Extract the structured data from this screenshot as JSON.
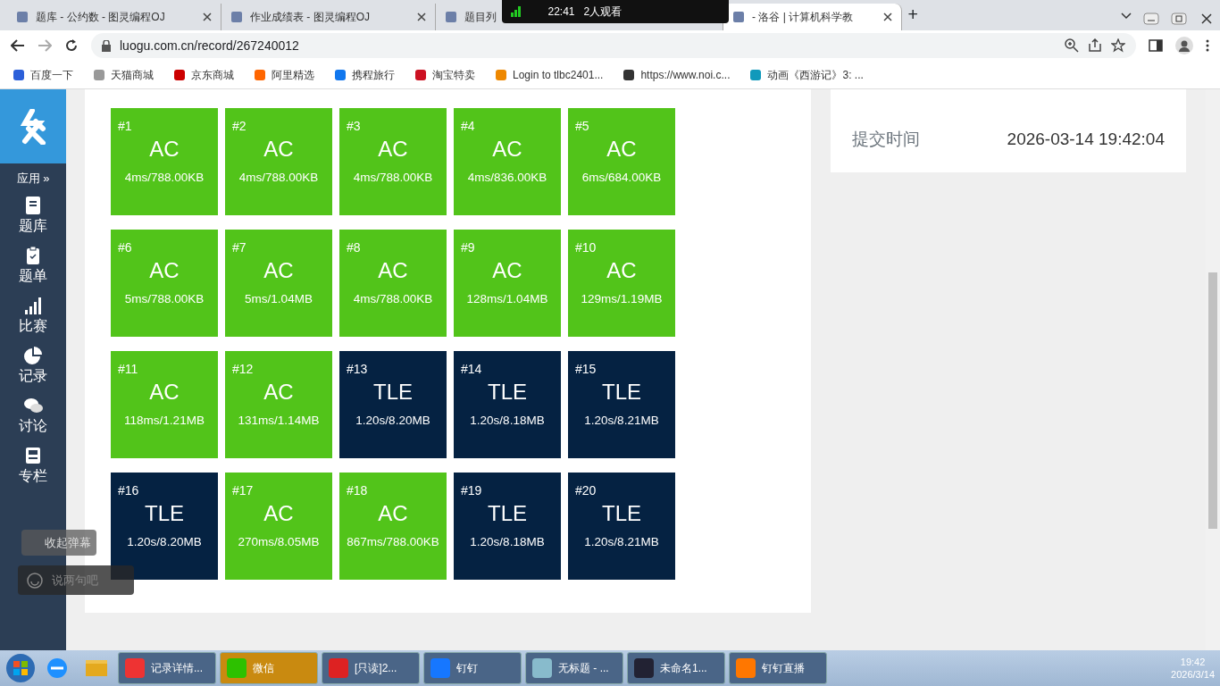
{
  "browser": {
    "tabs": [
      {
        "title": "题库 - 公约数 - 图灵编程OJ",
        "selected": false
      },
      {
        "title": "作业成绩表 - 图灵编程OJ",
        "selected": false
      },
      {
        "title": "题目列",
        "selected": false
      },
      {
        "title": "- 洛谷 | 计算机科学教",
        "selected": true
      }
    ],
    "new_tab": "+",
    "address": "luogu.com.cn/record/267240012",
    "bookmarks": [
      "百度一下",
      "天猫商城",
      "京东商城",
      "阿里精选",
      "携程旅行",
      "淘宝特卖",
      "Login to tlbc2401...",
      "https://www.noi.c...",
      "动画《西游记》3: ..."
    ]
  },
  "live_overlay": {
    "time": "22:41",
    "viewers": "2人观看"
  },
  "sidebar": {
    "apps": "应用 »",
    "items": [
      {
        "label": "题库",
        "kind": "book"
      },
      {
        "label": "题单",
        "kind": "clipboard"
      },
      {
        "label": "比赛",
        "kind": "bars"
      },
      {
        "label": "记录",
        "kind": "pie"
      },
      {
        "label": "讨论",
        "kind": "chat"
      },
      {
        "label": "专栏",
        "kind": "news"
      }
    ]
  },
  "testcases": [
    {
      "number": "#1",
      "status": "AC",
      "detail": "4ms/788.00KB"
    },
    {
      "number": "#2",
      "status": "AC",
      "detail": "4ms/788.00KB"
    },
    {
      "number": "#3",
      "status": "AC",
      "detail": "4ms/788.00KB"
    },
    {
      "number": "#4",
      "status": "AC",
      "detail": "4ms/836.00KB"
    },
    {
      "number": "#5",
      "status": "AC",
      "detail": "6ms/684.00KB"
    },
    {
      "number": "#6",
      "status": "AC",
      "detail": "5ms/788.00KB"
    },
    {
      "number": "#7",
      "status": "AC",
      "detail": "5ms/1.04MB"
    },
    {
      "number": "#8",
      "status": "AC",
      "detail": "4ms/788.00KB"
    },
    {
      "number": "#9",
      "status": "AC",
      "detail": "128ms/1.04MB"
    },
    {
      "number": "#10",
      "status": "AC",
      "detail": "129ms/1.19MB"
    },
    {
      "number": "#11",
      "status": "AC",
      "detail": "118ms/1.21MB"
    },
    {
      "number": "#12",
      "status": "AC",
      "detail": "131ms/1.14MB"
    },
    {
      "number": "#13",
      "status": "TLE",
      "detail": "1.20s/8.20MB"
    },
    {
      "number": "#14",
      "status": "TLE",
      "detail": "1.20s/8.18MB"
    },
    {
      "number": "#15",
      "status": "TLE",
      "detail": "1.20s/8.21MB"
    },
    {
      "number": "#16",
      "status": "TLE",
      "detail": "1.20s/8.20MB"
    },
    {
      "number": "#17",
      "status": "AC",
      "detail": "270ms/8.05MB"
    },
    {
      "number": "#18",
      "status": "AC",
      "detail": "867ms/788.00KB"
    },
    {
      "number": "#19",
      "status": "TLE",
      "detail": "1.20s/8.18MB"
    },
    {
      "number": "#20",
      "status": "TLE",
      "detail": "1.20s/8.21MB"
    }
  ],
  "record_info": [
    {
      "label": "提交时间",
      "value": "2026-03-14 19:42:04"
    }
  ],
  "danmaku": {
    "collapse": "收起弹幕",
    "input_placeholder": "说两句吧"
  },
  "taskbar": {
    "apps": [
      {
        "label": "记录详情...",
        "kind": "chrome",
        "selected": false
      },
      {
        "label": "微信",
        "kind": "wechat",
        "selected": true
      },
      {
        "label": "[只读]2...",
        "kind": "wps",
        "selected": false
      },
      {
        "label": "钉钉",
        "kind": "dingtalk",
        "selected": false
      },
      {
        "label": "无标题 - ...",
        "kind": "paint",
        "selected": false
      },
      {
        "label": "未命名1...",
        "kind": "dev",
        "selected": false
      },
      {
        "label": "钉钉直播",
        "kind": "live",
        "selected": false
      }
    ],
    "time": "19:42",
    "date": "2026/3/14"
  }
}
